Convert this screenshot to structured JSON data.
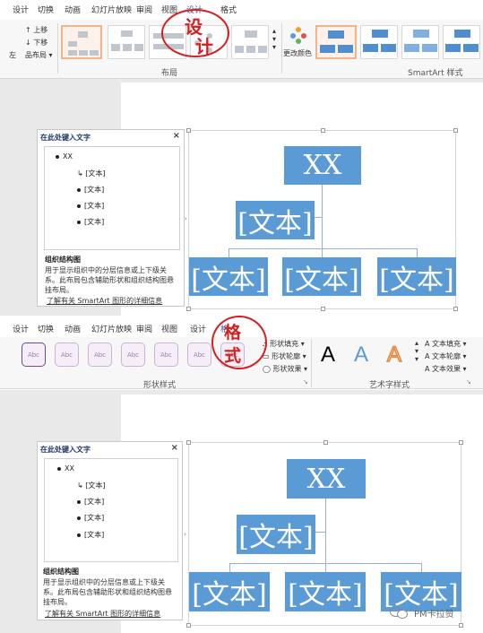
{
  "top_ribbon": {
    "tabs": [
      "设计",
      "切换",
      "动画",
      "幻灯片放映",
      "审阅",
      "视图",
      "设计",
      "格式"
    ],
    "commands": [
      "上移",
      "下移",
      "左",
      "布局"
    ],
    "layout_group": "布局",
    "change_colors": "更改颜色",
    "styles_group": "SmartArt 样式"
  },
  "annotation_top": {
    "text_1": "设",
    "text_2": "计"
  },
  "annotation_bottom": {
    "text_1": "格",
    "text_2": "式"
  },
  "text_pane": {
    "title": "在此处键入文字",
    "close": "×",
    "items": [
      "XX",
      "[文本]",
      "[文本]",
      "[文本]",
      "[文本]"
    ],
    "desc_title": "组织结构图",
    "desc": "用于显示组织中的分层信息或上下级关系。此布局包含辅助形状和组织结构图悬挂布局。",
    "link": "了解有关 SmartArt 图形的详细信息"
  },
  "diagram": {
    "top": "XX",
    "assistant": "[文本]",
    "children": [
      "[文本]",
      "[文本]",
      "[文本]"
    ]
  },
  "bottom_ribbon": {
    "tabs": [
      "设计",
      "切换",
      "动画",
      "幻灯片放映",
      "审阅",
      "视图",
      "设计",
      "格"
    ],
    "shape_style_label": "Abc",
    "shape_menu": [
      "形状填充",
      "形状轮廓",
      "形状效果"
    ],
    "shape_group": "形状样式",
    "wordart_letter": "A",
    "text_menu": [
      "文本填充",
      "文本轮廓",
      "文本效果"
    ],
    "wordart_group": "艺术字样式"
  },
  "watermark": {
    "text": "PM卡拉赞"
  },
  "colors": {
    "accent": "#5b9bd5",
    "annotation": "#d42020",
    "tab_active": "#2b579a"
  }
}
